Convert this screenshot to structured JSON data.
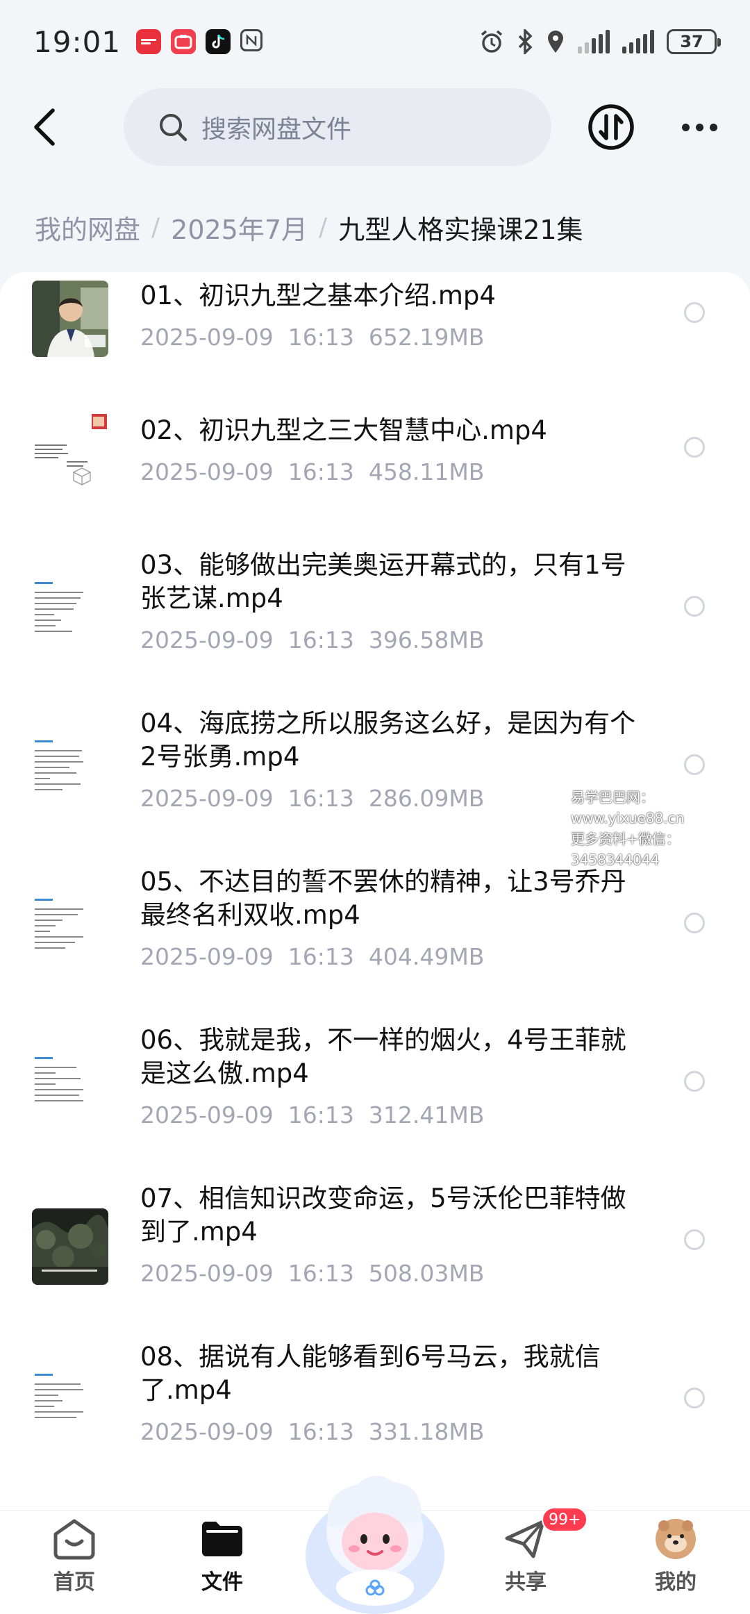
{
  "status_bar": {
    "time": "19:01",
    "battery": "37",
    "app_icons": [
      "huawei-app-icon",
      "xiaohongshu-icon",
      "tiktok-icon",
      "nfc-icon"
    ],
    "right_icons": [
      "alarm-icon",
      "bluetooth-icon",
      "location-icon",
      "signal-icon",
      "battery-icon"
    ]
  },
  "header": {
    "search_placeholder": "搜索网盘文件"
  },
  "breadcrumb": {
    "items": [
      "我的网盘",
      "2025年7月",
      "九型人格实操课21集"
    ]
  },
  "files": [
    {
      "name": "01、初识九型之基本介绍.mp4",
      "date": "2025-09-09",
      "time": "16:13",
      "size": "652.19MB",
      "thumb": "photo-thumbnail"
    },
    {
      "name": "02、初识九型之三大智慧中心.mp4",
      "date": "2025-09-09",
      "time": "16:13",
      "size": "458.11MB",
      "thumb": "slide-thumbnail"
    },
    {
      "name": "03、能够做出完美奥运开幕式的，只有1号张艺谋.mp4",
      "date": "2025-09-09",
      "time": "16:13",
      "size": "396.58MB",
      "thumb": "text-thumbnail"
    },
    {
      "name": "04、海底捞之所以服务这么好，是因为有个2号张勇.mp4",
      "date": "2025-09-09",
      "time": "16:13",
      "size": "286.09MB",
      "thumb": "text-thumbnail"
    },
    {
      "name": "05、不达目的誓不罢休的精神，让3号乔丹最终名利双收.mp4",
      "date": "2025-09-09",
      "time": "16:13",
      "size": "404.49MB",
      "thumb": "text-thumbnail"
    },
    {
      "name": "06、我就是我，不一样的烟火，4号王菲就是这么傲.mp4",
      "date": "2025-09-09",
      "time": "16:13",
      "size": "312.41MB",
      "thumb": "text-thumbnail"
    },
    {
      "name": "07、相信知识改变命运，5号沃伦巴菲特做到了.mp4",
      "date": "2025-09-09",
      "time": "16:13",
      "size": "508.03MB",
      "thumb": "dark-photo-thumbnail"
    },
    {
      "name": "08、据说有人能够看到6号马云，我就信了.mp4",
      "date": "2025-09-09",
      "time": "16:13",
      "size": "331.18MB",
      "thumb": "text-thumbnail"
    }
  ],
  "watermark": {
    "line1": "易学巴巴网：www.yixue88.cn",
    "line2": "更多资料+微信：3458344044"
  },
  "bottom_nav": {
    "items": [
      {
        "label": "首页",
        "icon": "home-icon"
      },
      {
        "label": "文件",
        "icon": "folder-icon"
      },
      {
        "label": "共享",
        "icon": "share-icon"
      },
      {
        "label": "我的",
        "icon": "profile-avatar"
      }
    ],
    "share_badge": "99+",
    "active": "文件"
  },
  "colors": {
    "background": "#f4f5f8",
    "search_bg": "#e9ebf2",
    "meta_text": "#a3a7b4",
    "badge": "#ff3b4f"
  }
}
